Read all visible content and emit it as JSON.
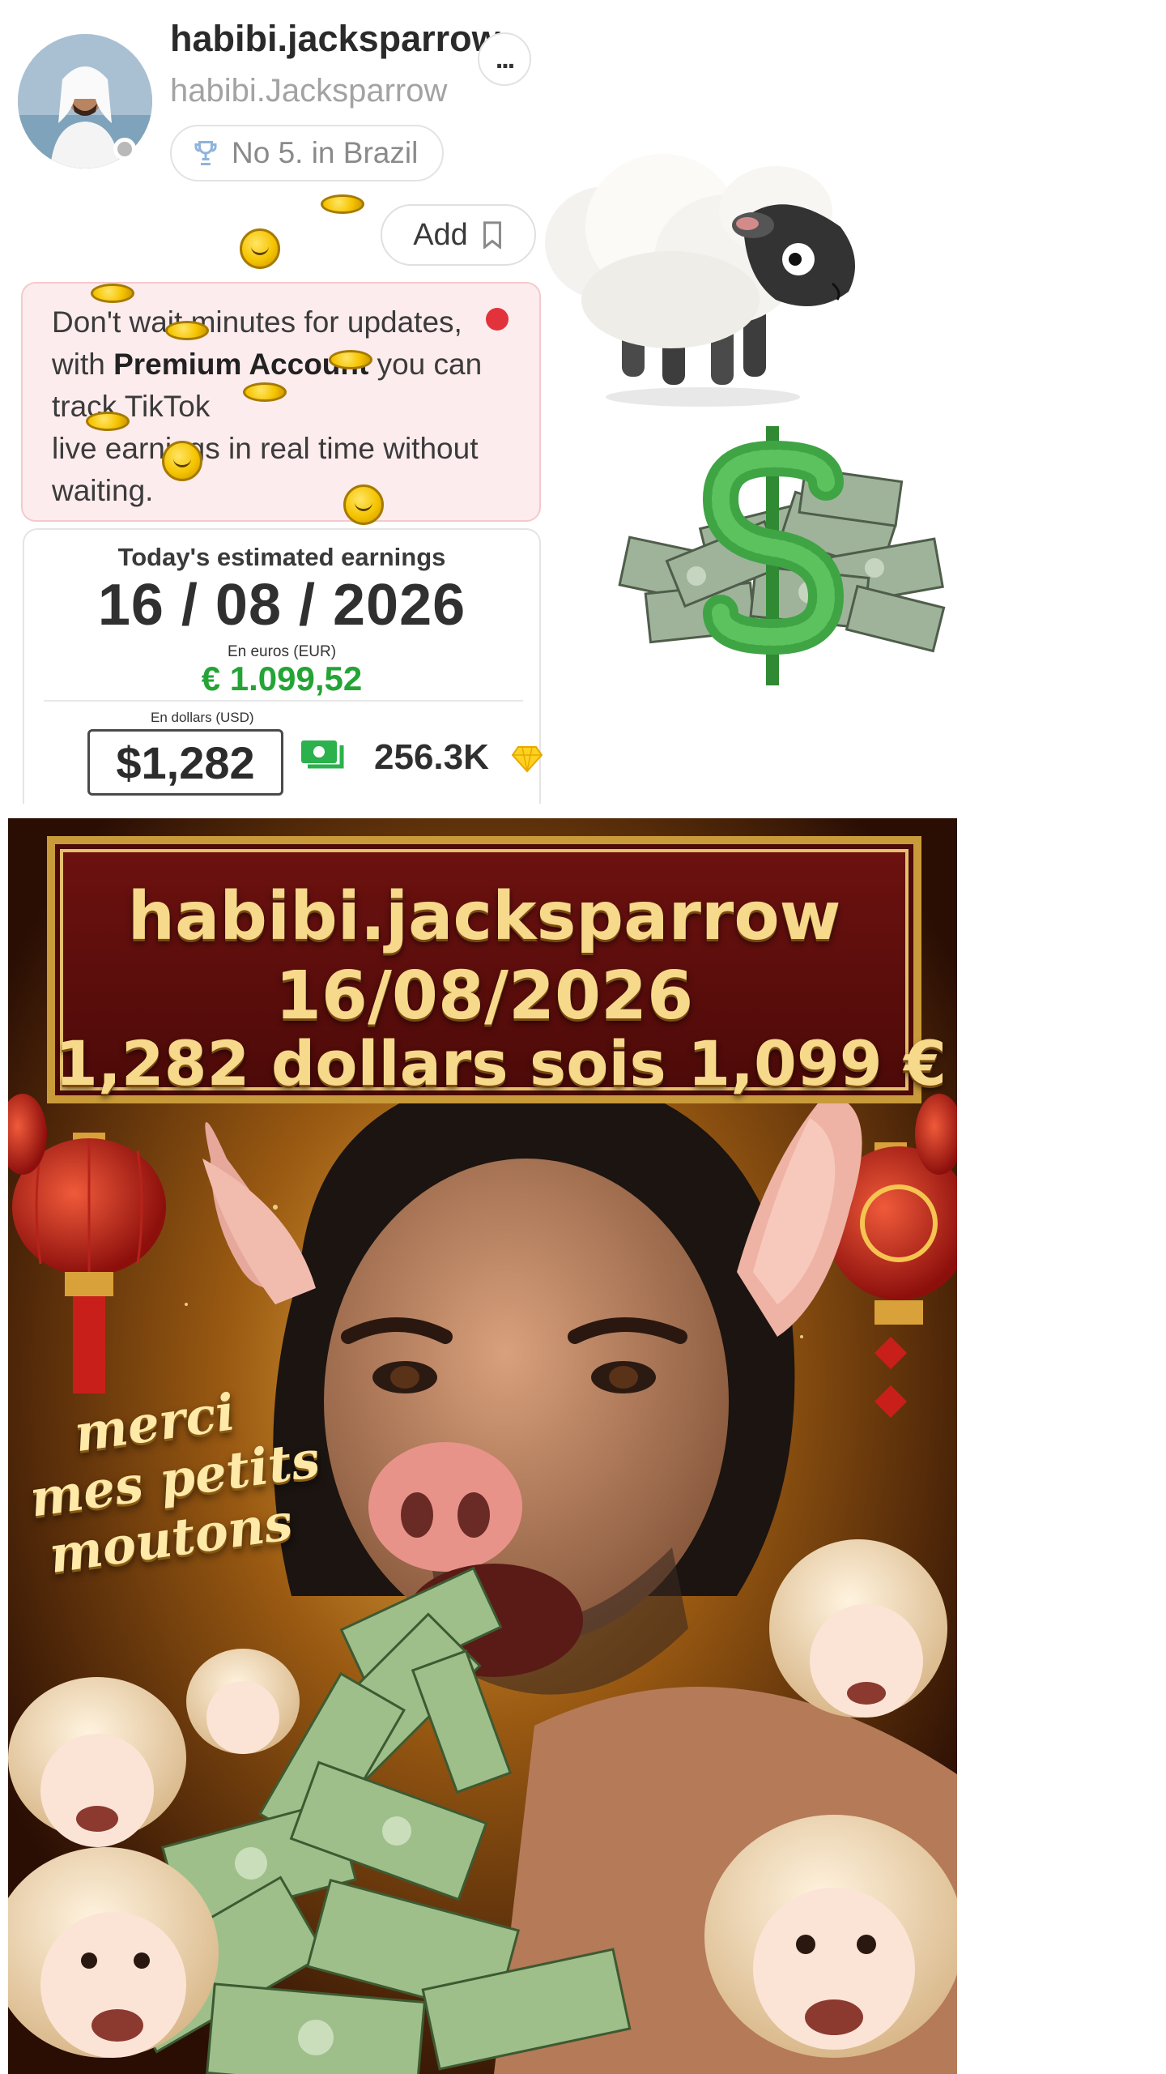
{
  "profile": {
    "username": "habibi.jacksparrow",
    "handle": "habibi.Jacksparrow",
    "rank_label": "No 5. in Brazil",
    "more_label": "...",
    "add_label": "Add"
  },
  "premium": {
    "line1": "Don't wait minutes for updates,",
    "line2_pre": "with ",
    "line2_bold": "Premium Account",
    "line2_post": " you can",
    "line3": "track TikTok",
    "line4": "live earnings in real time without",
    "line5": "waiting."
  },
  "earnings": {
    "title": "Today's estimated earnings",
    "date": "16 / 08 / 2026",
    "eur_label": "En euros (EUR)",
    "eur_value": "€ 1.099,52",
    "usd_label": "En dollars (USD)",
    "usd_value": "$1,282",
    "diamonds_value": "256.3K"
  },
  "poster": {
    "line1": "habibi.jacksparrow",
    "line2": "16/08/2026",
    "line3": "1,282 dollars sois 1,099 €",
    "merci_line1": "merci",
    "merci_line2": "mes petits",
    "merci_line3": "moutons"
  },
  "colors": {
    "accent_green": "#23a435",
    "alert_red": "#e2323c",
    "premium_bg": "#fdeced",
    "poster_gold": "#f7d98b"
  },
  "icons": [
    "more-icon",
    "trophy-icon",
    "bookmark-icon",
    "coin-icon",
    "cash-icon",
    "diamond-icon",
    "sheep-sticker",
    "money-sticker"
  ]
}
